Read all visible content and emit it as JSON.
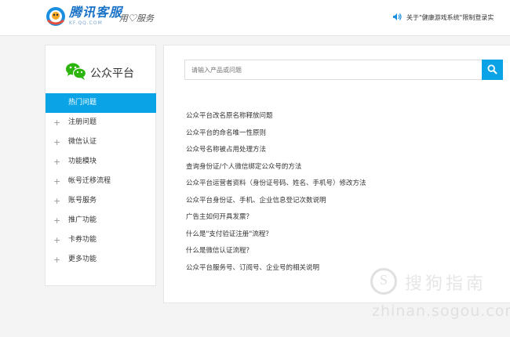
{
  "header": {
    "brand_name": "腾讯客服",
    "brand_url": "KF.QQ.COM",
    "slogan": "用♡服务",
    "notice": "关于\"健康游戏系统\"限制登录实"
  },
  "sidebar": {
    "title": "公众平台",
    "items": [
      {
        "label": "热门问题"
      },
      {
        "label": "注册问题"
      },
      {
        "label": "微信认证"
      },
      {
        "label": "功能模块"
      },
      {
        "label": "帐号迁移流程"
      },
      {
        "label": "账号服务"
      },
      {
        "label": "推广功能"
      },
      {
        "label": "卡券功能"
      },
      {
        "label": "更多功能"
      }
    ],
    "expand_symbol": "+"
  },
  "search": {
    "placeholder": "请输入产品或问题"
  },
  "questions": [
    "公众平台改名原名称释放问题",
    "公众平台的命名唯一性原则",
    "公众号名称被占用处理方法",
    "查询身份证/个人微信绑定公众号的方法",
    "公众平台运营者资料（身份证号码、姓名、手机号）修改方法",
    "公众平台身份证、手机、企业信息登记次数说明",
    "广告主如何开具发票？",
    "什么是\"支付验证注册\"流程？",
    "什么是微信认证流程？",
    "公众平台服务号、订阅号、企业号的相关说明"
  ],
  "watermark": {
    "symbol": "S",
    "cn": "搜狗指南",
    "en": "zhinan.sogou.com"
  },
  "colors": {
    "accent": "#0aa3e5",
    "wechat_green": "#2db40d",
    "brand_blue": "#1a73c6"
  }
}
